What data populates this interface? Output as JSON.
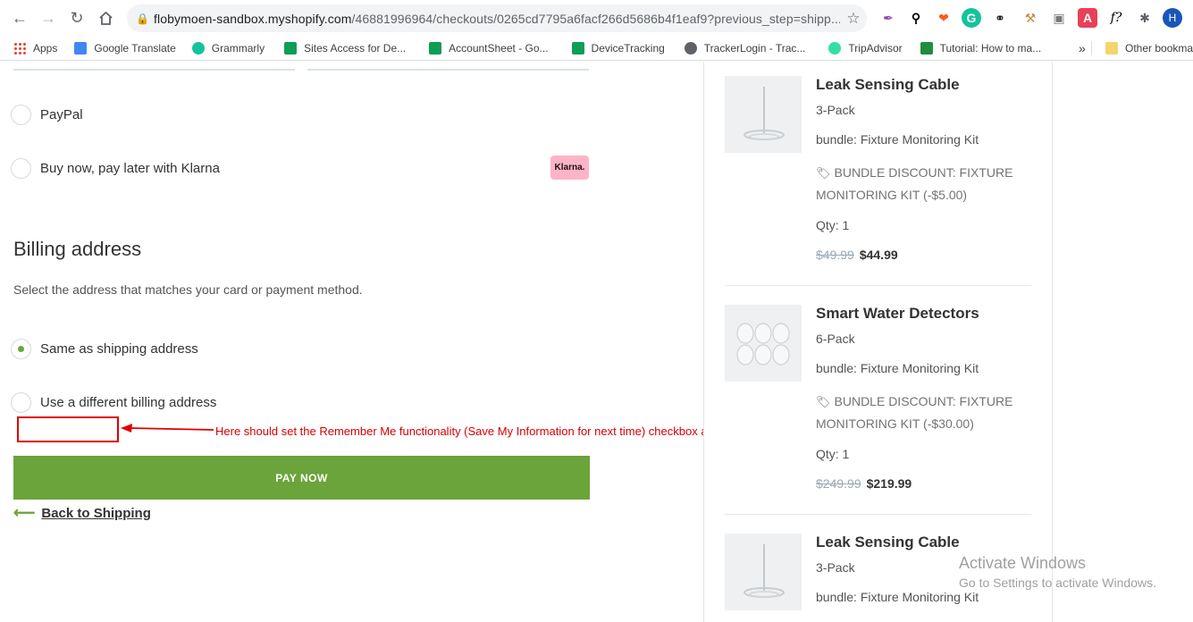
{
  "browser": {
    "url_host": "flobymoen-sandbox.myshopify.com",
    "url_path": "/46881996964/checkouts/0265cd7795a6facf266d5686b4f1eaf9?previous_step=shipp...",
    "avatar_letter": "H",
    "ext_f_label": "f?"
  },
  "bookmarks": [
    {
      "label": "Apps",
      "icon": "apps-grid-icon",
      "color": "#ea4335"
    },
    {
      "label": "Google Translate",
      "icon": "google-translate-icon",
      "color": "#4285f4"
    },
    {
      "label": "Grammarly",
      "icon": "grammarly-icon",
      "color": "#15c39a"
    },
    {
      "label": "Sites Access for De...",
      "icon": "google-sheets-icon",
      "color": "#0f9d58"
    },
    {
      "label": "AccountSheet - Go...",
      "icon": "google-sheets-icon",
      "color": "#0f9d58"
    },
    {
      "label": "DeviceTracking",
      "icon": "google-sheets-icon",
      "color": "#0f9d58"
    },
    {
      "label": "TrackerLogin - Trac...",
      "icon": "globe-icon",
      "color": "#5f6368"
    },
    {
      "label": "TripAdvisor",
      "icon": "tripadvisor-icon",
      "color": "#34e0a1"
    },
    {
      "label": "Tutorial: How to ma...",
      "icon": "tutorial-icon",
      "color": "#1e8e3e"
    }
  ],
  "bookmarks_more": "»",
  "other_bookmarks": "Other bookma",
  "payment": {
    "paypal_label": "PayPal",
    "klarna_label": "Buy now, pay later with Klarna",
    "klarna_badge": "Klarna."
  },
  "billing": {
    "title": "Billing address",
    "subtitle": "Select the address that matches your card or payment method.",
    "option_same": "Same as shipping address",
    "option_different": "Use a different billing address",
    "selected": "same"
  },
  "annotation": {
    "text": "Here should set the Remember Me functionality (Save My Information for next time) checkbox as per figma file",
    "color": "#d60000"
  },
  "actions": {
    "pay_now": "PAY NOW",
    "back_to_shipping": "Back to Shipping"
  },
  "summary": {
    "items": [
      {
        "name": "Leak Sensing Cable",
        "variant": "3-Pack",
        "bundle": "bundle: Fixture Monitoring Kit",
        "discount": "BUNDLE DISCOUNT: FIXTURE MONITORING KIT (-$5.00)",
        "qty": "Qty: 1",
        "old_price": "$49.99",
        "price": "$44.99"
      },
      {
        "name": "Smart Water Detectors",
        "variant": "6-Pack",
        "bundle": "bundle: Fixture Monitoring Kit",
        "discount": "BUNDLE DISCOUNT: FIXTURE MONITORING KIT (-$30.00)",
        "qty": "Qty: 1",
        "old_price": "$249.99",
        "price": "$219.99"
      },
      {
        "name": "Leak Sensing Cable",
        "variant": "3-Pack",
        "bundle": "bundle: Fixture Monitoring Kit"
      }
    ]
  },
  "watermark": {
    "line1": "Activate Windows",
    "line2": "Go to Settings to activate Windows."
  },
  "colors": {
    "accent_green": "#6aa43a",
    "klarna_pink": "#ffb3c7"
  }
}
